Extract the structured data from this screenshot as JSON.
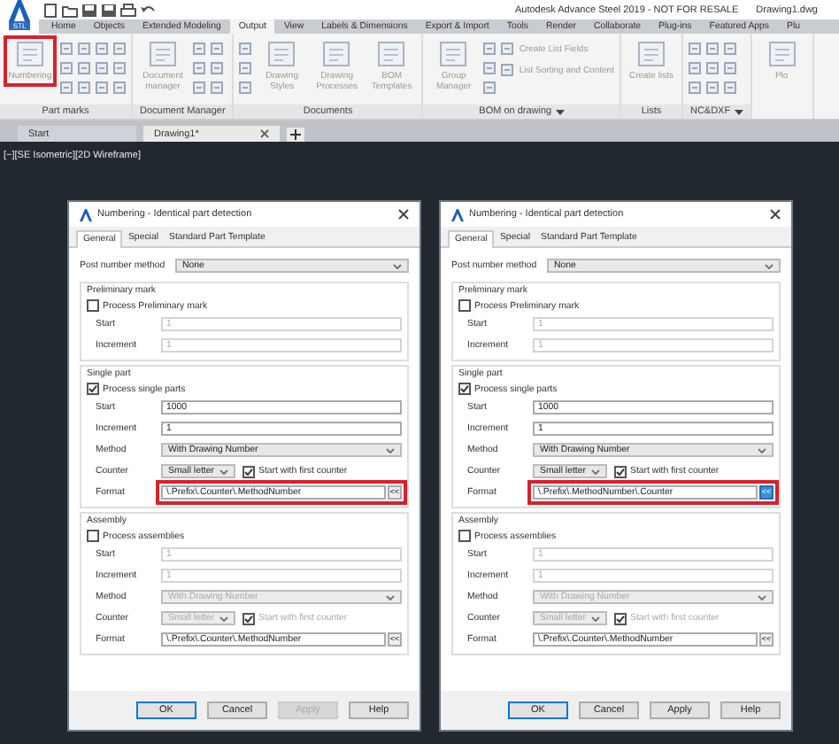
{
  "title_bar": {
    "logo_caption": "STL",
    "title": "Autodesk Advance Steel 2019 - NOT FOR RESALE",
    "document": "Drawing1.dwg"
  },
  "ribbon_tabs": [
    {
      "label": "Home",
      "selected": false
    },
    {
      "label": "Objects",
      "selected": false
    },
    {
      "label": "Extended Modeling",
      "selected": false
    },
    {
      "label": "Output",
      "selected": true
    },
    {
      "label": "View",
      "selected": false
    },
    {
      "label": "Labels & Dimensions",
      "selected": false
    },
    {
      "label": "Export & Import",
      "selected": false
    },
    {
      "label": "Tools",
      "selected": false
    },
    {
      "label": "Render",
      "selected": false
    },
    {
      "label": "Collaborate",
      "selected": false
    },
    {
      "label": "Plug-ins",
      "selected": false
    },
    {
      "label": "Featured Apps",
      "selected": false
    },
    {
      "label": "Plu",
      "selected": false
    }
  ],
  "ribbon_panels": [
    {
      "label": "Part marks",
      "has_menu": false,
      "tools": [
        {
          "kind": "large",
          "label": "Numbering",
          "highlighted": true
        },
        {
          "kind": "icons"
        },
        {
          "kind": "icons"
        },
        {
          "kind": "icons"
        },
        {
          "kind": "icons"
        }
      ]
    },
    {
      "label": "Document Manager",
      "has_menu": false,
      "tools": [
        {
          "kind": "large",
          "label": "Document manager",
          "highlighted": false
        },
        {
          "kind": "icons"
        },
        {
          "kind": "icons"
        }
      ]
    },
    {
      "label": "Documents",
      "has_menu": false,
      "tools": [
        {
          "kind": "icons"
        },
        {
          "kind": "large",
          "label": "Drawing Styles",
          "highlighted": false
        },
        {
          "kind": "large",
          "label": "Drawing Processes",
          "highlighted": false
        },
        {
          "kind": "large",
          "label": "BOM Templates",
          "highlighted": false
        }
      ]
    },
    {
      "label": "BOM on drawing",
      "has_menu": true,
      "tools": [
        {
          "kind": "large",
          "label": "Group Manager",
          "highlighted": false
        },
        {
          "kind": "icons"
        },
        {
          "kind": "stack",
          "items": [
            {
              "label": "Create List Fields"
            },
            {
              "label": "List Sorting and Content"
            }
          ]
        }
      ]
    },
    {
      "label": "Lists",
      "has_menu": false,
      "tools": [
        {
          "kind": "large",
          "label": "Create lists",
          "highlighted": false
        }
      ]
    },
    {
      "label": "NC&DXF",
      "has_menu": true,
      "tools": [
        {
          "kind": "icons"
        },
        {
          "kind": "icons"
        },
        {
          "kind": "icons"
        }
      ]
    },
    {
      "tools": [
        {
          "kind": "large",
          "label": "Plo",
          "highlighted": false
        }
      ]
    }
  ],
  "document_tabs": [
    {
      "label": "Start",
      "selected": false
    },
    {
      "label": "Drawing1*",
      "selected": true,
      "closable": true
    }
  ],
  "viewport": {
    "label": "[−][SE Isometric][2D Wireframe]"
  },
  "dialogs": [
    {
      "title": "Numbering - Identical part detection",
      "tabs": [
        {
          "label": "General",
          "selected": true
        },
        {
          "label": "Special",
          "selected": false
        },
        {
          "label": "Standard Part Template",
          "selected": false
        }
      ],
      "post_number_method": {
        "label": "Post number method",
        "value": "None"
      },
      "groups": [
        {
          "title": "Preliminary mark",
          "check": {
            "label": "Process Preliminary mark",
            "checked": false
          },
          "rows": [
            {
              "kind": "text",
              "label": "Start",
              "value": "1",
              "disabled": true
            },
            {
              "kind": "text",
              "label": "Increment",
              "value": "1",
              "disabled": true
            }
          ]
        },
        {
          "title": "Single part",
          "check": {
            "label": "Process single parts",
            "checked": true
          },
          "rows": [
            {
              "kind": "text",
              "label": "Start",
              "value": "1000",
              "disabled": false
            },
            {
              "kind": "text",
              "label": "Increment",
              "value": "1",
              "disabled": false
            },
            {
              "kind": "select",
              "label": "Method",
              "value": "With Drawing Number",
              "disabled": false
            },
            {
              "kind": "counter",
              "label": "Counter",
              "value": "Small letter",
              "disabled": false,
              "check": {
                "label": "Start with first counter",
                "checked": true
              }
            },
            {
              "kind": "format",
              "label": "Format",
              "value": "\\.Prefix\\.Counter\\.MethodNumber",
              "disabled": false,
              "highlighted": true,
              "button": "<<",
              "button_active": false
            }
          ]
        },
        {
          "title": "Assembly",
          "check": {
            "label": "Process assemblies",
            "checked": false
          },
          "rows": [
            {
              "kind": "text",
              "label": "Start",
              "value": "1",
              "disabled": true
            },
            {
              "kind": "text",
              "label": "Increment",
              "value": "1",
              "disabled": true
            },
            {
              "kind": "select",
              "label": "Method",
              "value": "With Drawing Number",
              "disabled": true
            },
            {
              "kind": "counter",
              "label": "Counter",
              "value": "Small letter",
              "disabled": true,
              "check": {
                "label": "Start with first counter",
                "checked": true
              }
            },
            {
              "kind": "format",
              "label": "Format",
              "value": "\\.Prefix\\.Counter\\.MethodNumber",
              "disabled": false,
              "highlighted": false,
              "button": "<<",
              "button_active": false
            }
          ]
        }
      ],
      "buttons": [
        {
          "label": "OK",
          "default": true,
          "disabled": false
        },
        {
          "label": "Cancel",
          "default": false,
          "disabled": false
        },
        {
          "label": "Apply",
          "default": false,
          "disabled": true
        },
        {
          "label": "Help",
          "default": false,
          "disabled": false
        }
      ]
    },
    {
      "title": "Numbering - Identical part detection",
      "tabs": [
        {
          "label": "General",
          "selected": true
        },
        {
          "label": "Special",
          "selected": false
        },
        {
          "label": "Standard Part Template",
          "selected": false
        }
      ],
      "post_number_method": {
        "label": "Post number method",
        "value": "None"
      },
      "groups": [
        {
          "title": "Preliminary mark",
          "check": {
            "label": "Process Preliminary mark",
            "checked": false
          },
          "rows": [
            {
              "kind": "text",
              "label": "Start",
              "value": "1",
              "disabled": true
            },
            {
              "kind": "text",
              "label": "Increment",
              "value": "1",
              "disabled": true
            }
          ]
        },
        {
          "title": "Single part",
          "check": {
            "label": "Process single parts",
            "checked": true
          },
          "rows": [
            {
              "kind": "text",
              "label": "Start",
              "value": "1000",
              "disabled": false
            },
            {
              "kind": "text",
              "label": "Increment",
              "value": "1",
              "disabled": false
            },
            {
              "kind": "select",
              "label": "Method",
              "value": "With Drawing Number",
              "disabled": false
            },
            {
              "kind": "counter",
              "label": "Counter",
              "value": "Small letter",
              "disabled": false,
              "check": {
                "label": "Start with first counter",
                "checked": true
              }
            },
            {
              "kind": "format",
              "label": "Format",
              "value": "\\.Prefix\\.MethodNumber\\.Counter",
              "disabled": false,
              "highlighted": true,
              "button": "<<",
              "button_active": true
            }
          ]
        },
        {
          "title": "Assembly",
          "check": {
            "label": "Process assemblies",
            "checked": false
          },
          "rows": [
            {
              "kind": "text",
              "label": "Start",
              "value": "1",
              "disabled": true
            },
            {
              "kind": "text",
              "label": "Increment",
              "value": "1",
              "disabled": true
            },
            {
              "kind": "select",
              "label": "Method",
              "value": "With Drawing Number",
              "disabled": true
            },
            {
              "kind": "counter",
              "label": "Counter",
              "value": "Small letter",
              "disabled": true,
              "check": {
                "label": "Start with first counter",
                "checked": true
              }
            },
            {
              "kind": "format",
              "label": "Format",
              "value": "\\.Prefix\\.Counter\\.MethodNumber",
              "disabled": false,
              "highlighted": false,
              "button": "<<",
              "button_active": false
            }
          ]
        }
      ],
      "buttons": [
        {
          "label": "OK",
          "default": true,
          "disabled": false
        },
        {
          "label": "Cancel",
          "default": false,
          "disabled": false
        },
        {
          "label": "Apply",
          "default": false,
          "disabled": false
        },
        {
          "label": "Help",
          "default": false,
          "disabled": false
        }
      ]
    }
  ]
}
